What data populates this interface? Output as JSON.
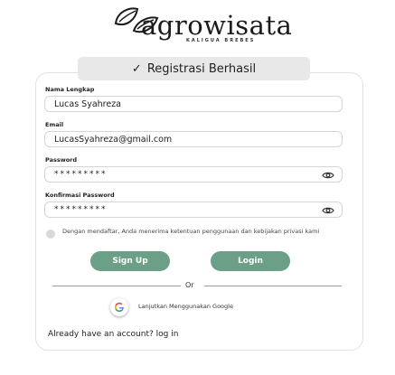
{
  "logo": {
    "name": "agrowisata",
    "subtitle": "KALIGUA BREBES"
  },
  "toast": {
    "message": "Registrasi Berhasil"
  },
  "form": {
    "name_label": "Nama Lengkap",
    "name_value": "Lucas Syahreza",
    "email_label": "Email",
    "email_value": "LucasSyahreza@gmail.com",
    "password_label": "Password",
    "password_value": "*********",
    "confirm_label": "Konfirmasi Password",
    "confirm_value": "*********",
    "terms_text": "Dengan mendaftar, Anda menerima ketentuan penggunaan dan kebijakan privasi kami"
  },
  "buttons": {
    "signup": "Sign Up",
    "login": "Login"
  },
  "divider": {
    "or": "Or"
  },
  "google": {
    "label": "Lanjutkan Menggunakan Google"
  },
  "footer": {
    "already": "Already have an account? log in"
  },
  "colors": {
    "primary": "#6b9f87",
    "toast_bg": "#e8e8e8"
  }
}
